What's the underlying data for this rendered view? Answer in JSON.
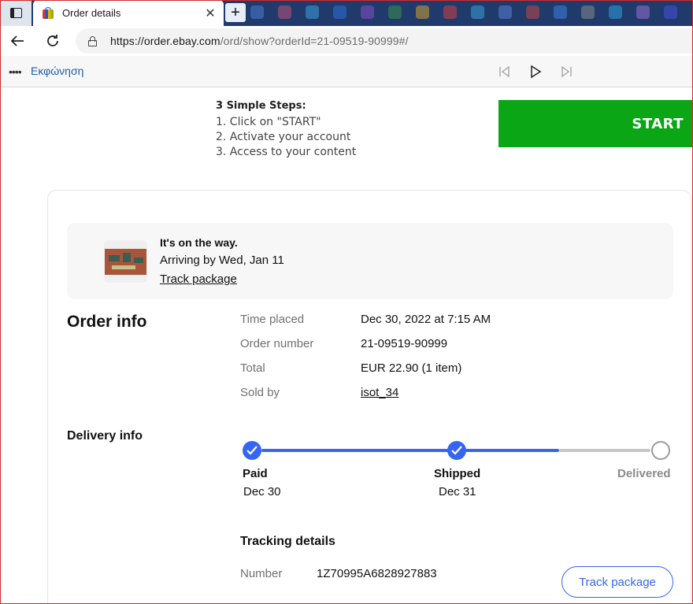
{
  "browser": {
    "tab_title": "Order details",
    "tab_close": "✕",
    "new_tab": "+",
    "url_host": "https://order.ebay.com",
    "url_path": "/ord/show?orderId=21-09519-90999#/",
    "read_aloud_label": "Εκφώνηση",
    "read_aloud_menu": "••••",
    "ghost_tab_colors": [
      "#4a7bd0",
      "#c0507a",
      "#3aa0d8",
      "#2f6fd6",
      "#8a4fc4",
      "#3b8f4a",
      "#d0a030",
      "#d04040",
      "#3a9fd8",
      "#5a7fd0",
      "#c04848",
      "#3a7fe0",
      "#888888",
      "#2f9fdf",
      "#9a6fd0",
      "#4a4fe0"
    ]
  },
  "promo": {
    "title": "3 Simple Steps:",
    "steps": [
      "1. Click on \"START\"",
      "2. Activate your account",
      "3. Access to your content"
    ],
    "start_label": "START",
    "start_color": "#0ba616"
  },
  "status": {
    "title": "It's on the way.",
    "arriving": "Arriving by Wed, Jan 11",
    "track_link": "Track package"
  },
  "order_info": {
    "heading": "Order info",
    "rows": [
      {
        "label": "Time placed",
        "value": "Dec 30, 2022 at 7:15 AM"
      },
      {
        "label": "Order number",
        "value": "21-09519-90999"
      },
      {
        "label": "Total",
        "value": "EUR 22.90 (1 item)"
      },
      {
        "label": "Sold by",
        "value": "isot_34"
      }
    ]
  },
  "delivery": {
    "heading": "Delivery info",
    "accent_color": "#3665f3",
    "stages": [
      {
        "label": "Paid",
        "date": "Dec 30",
        "done": true
      },
      {
        "label": "Shipped",
        "date": "Dec 31",
        "done": true
      },
      {
        "label": "Delivered",
        "date": "",
        "done": false
      }
    ],
    "tracking": {
      "heading": "Tracking details",
      "number_label": "Number",
      "number": "1Z70995A6828927883",
      "button": "Track package"
    }
  }
}
